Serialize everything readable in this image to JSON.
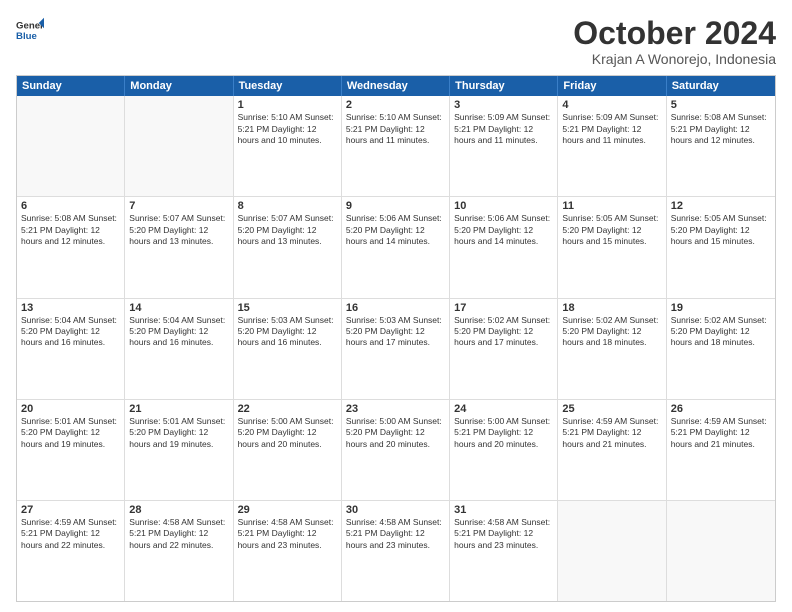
{
  "logo": {
    "line1": "General",
    "line2": "Blue"
  },
  "title": "October 2024",
  "subtitle": "Krajan A Wonorejo, Indonesia",
  "header_days": [
    "Sunday",
    "Monday",
    "Tuesday",
    "Wednesday",
    "Thursday",
    "Friday",
    "Saturday"
  ],
  "weeks": [
    [
      {
        "day": "",
        "text": ""
      },
      {
        "day": "",
        "text": ""
      },
      {
        "day": "1",
        "text": "Sunrise: 5:10 AM\nSunset: 5:21 PM\nDaylight: 12 hours\nand 10 minutes."
      },
      {
        "day": "2",
        "text": "Sunrise: 5:10 AM\nSunset: 5:21 PM\nDaylight: 12 hours\nand 11 minutes."
      },
      {
        "day": "3",
        "text": "Sunrise: 5:09 AM\nSunset: 5:21 PM\nDaylight: 12 hours\nand 11 minutes."
      },
      {
        "day": "4",
        "text": "Sunrise: 5:09 AM\nSunset: 5:21 PM\nDaylight: 12 hours\nand 11 minutes."
      },
      {
        "day": "5",
        "text": "Sunrise: 5:08 AM\nSunset: 5:21 PM\nDaylight: 12 hours\nand 12 minutes."
      }
    ],
    [
      {
        "day": "6",
        "text": "Sunrise: 5:08 AM\nSunset: 5:21 PM\nDaylight: 12 hours\nand 12 minutes."
      },
      {
        "day": "7",
        "text": "Sunrise: 5:07 AM\nSunset: 5:20 PM\nDaylight: 12 hours\nand 13 minutes."
      },
      {
        "day": "8",
        "text": "Sunrise: 5:07 AM\nSunset: 5:20 PM\nDaylight: 12 hours\nand 13 minutes."
      },
      {
        "day": "9",
        "text": "Sunrise: 5:06 AM\nSunset: 5:20 PM\nDaylight: 12 hours\nand 14 minutes."
      },
      {
        "day": "10",
        "text": "Sunrise: 5:06 AM\nSunset: 5:20 PM\nDaylight: 12 hours\nand 14 minutes."
      },
      {
        "day": "11",
        "text": "Sunrise: 5:05 AM\nSunset: 5:20 PM\nDaylight: 12 hours\nand 15 minutes."
      },
      {
        "day": "12",
        "text": "Sunrise: 5:05 AM\nSunset: 5:20 PM\nDaylight: 12 hours\nand 15 minutes."
      }
    ],
    [
      {
        "day": "13",
        "text": "Sunrise: 5:04 AM\nSunset: 5:20 PM\nDaylight: 12 hours\nand 16 minutes."
      },
      {
        "day": "14",
        "text": "Sunrise: 5:04 AM\nSunset: 5:20 PM\nDaylight: 12 hours\nand 16 minutes."
      },
      {
        "day": "15",
        "text": "Sunrise: 5:03 AM\nSunset: 5:20 PM\nDaylight: 12 hours\nand 16 minutes."
      },
      {
        "day": "16",
        "text": "Sunrise: 5:03 AM\nSunset: 5:20 PM\nDaylight: 12 hours\nand 17 minutes."
      },
      {
        "day": "17",
        "text": "Sunrise: 5:02 AM\nSunset: 5:20 PM\nDaylight: 12 hours\nand 17 minutes."
      },
      {
        "day": "18",
        "text": "Sunrise: 5:02 AM\nSunset: 5:20 PM\nDaylight: 12 hours\nand 18 minutes."
      },
      {
        "day": "19",
        "text": "Sunrise: 5:02 AM\nSunset: 5:20 PM\nDaylight: 12 hours\nand 18 minutes."
      }
    ],
    [
      {
        "day": "20",
        "text": "Sunrise: 5:01 AM\nSunset: 5:20 PM\nDaylight: 12 hours\nand 19 minutes."
      },
      {
        "day": "21",
        "text": "Sunrise: 5:01 AM\nSunset: 5:20 PM\nDaylight: 12 hours\nand 19 minutes."
      },
      {
        "day": "22",
        "text": "Sunrise: 5:00 AM\nSunset: 5:20 PM\nDaylight: 12 hours\nand 20 minutes."
      },
      {
        "day": "23",
        "text": "Sunrise: 5:00 AM\nSunset: 5:20 PM\nDaylight: 12 hours\nand 20 minutes."
      },
      {
        "day": "24",
        "text": "Sunrise: 5:00 AM\nSunset: 5:21 PM\nDaylight: 12 hours\nand 20 minutes."
      },
      {
        "day": "25",
        "text": "Sunrise: 4:59 AM\nSunset: 5:21 PM\nDaylight: 12 hours\nand 21 minutes."
      },
      {
        "day": "26",
        "text": "Sunrise: 4:59 AM\nSunset: 5:21 PM\nDaylight: 12 hours\nand 21 minutes."
      }
    ],
    [
      {
        "day": "27",
        "text": "Sunrise: 4:59 AM\nSunset: 5:21 PM\nDaylight: 12 hours\nand 22 minutes."
      },
      {
        "day": "28",
        "text": "Sunrise: 4:58 AM\nSunset: 5:21 PM\nDaylight: 12 hours\nand 22 minutes."
      },
      {
        "day": "29",
        "text": "Sunrise: 4:58 AM\nSunset: 5:21 PM\nDaylight: 12 hours\nand 23 minutes."
      },
      {
        "day": "30",
        "text": "Sunrise: 4:58 AM\nSunset: 5:21 PM\nDaylight: 12 hours\nand 23 minutes."
      },
      {
        "day": "31",
        "text": "Sunrise: 4:58 AM\nSunset: 5:21 PM\nDaylight: 12 hours\nand 23 minutes."
      },
      {
        "day": "",
        "text": ""
      },
      {
        "day": "",
        "text": ""
      }
    ]
  ]
}
